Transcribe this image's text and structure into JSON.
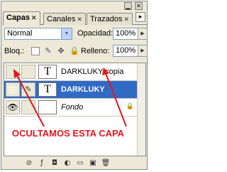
{
  "tabs": [
    {
      "label": "Capas",
      "active": true
    },
    {
      "label": "Canales",
      "active": false
    },
    {
      "label": "Trazados",
      "active": false
    }
  ],
  "blend_mode": "Normal",
  "opacity_label": "Opacidad:",
  "opacity_value": "100%",
  "lock_label": "Bloq.:",
  "fill_label": "Relleno:",
  "fill_value": "100%",
  "layers": [
    {
      "name": "DARKLUKY copia",
      "thumb": "T",
      "visible": false,
      "selected": false
    },
    {
      "name": "DARKLUKY",
      "thumb": "T",
      "visible": true,
      "selected": true
    },
    {
      "name": "Fondo",
      "thumb": "",
      "visible": true,
      "selected": false,
      "locked": true
    }
  ],
  "annotation": "OCULTAMOS ESTA CAPA",
  "colors": {
    "annotation": "#e3161b",
    "selection": "#316ac5"
  }
}
